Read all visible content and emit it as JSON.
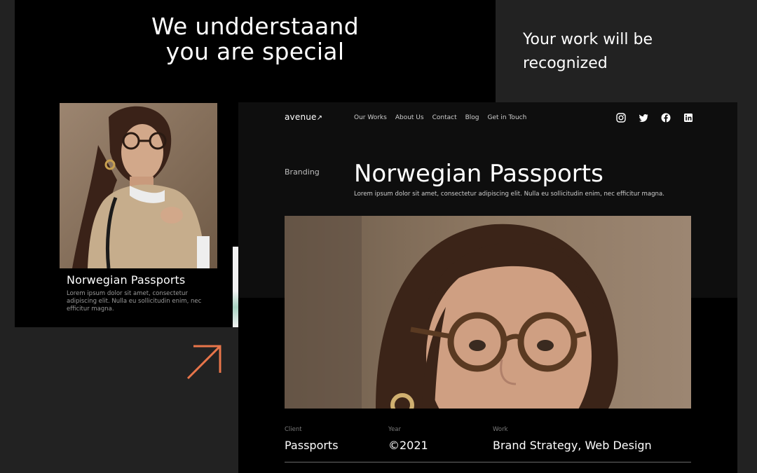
{
  "left_panel": {
    "heading_line1": "We undderstaand",
    "heading_line2": "you are special",
    "card": {
      "title": "Norwegian Passports",
      "description": "Lorem ipsum dolor sit amet, consectetur adipiscing elit. Nulla eu sollicitudin enim, nec efficitur magna."
    }
  },
  "tagline": "Your work will be recognized",
  "decor": {
    "arrow_icon": "arrow-up-right-icon",
    "arrow_color": "#e8754a"
  },
  "site": {
    "logo": "avenue",
    "logo_icon": "arrow-up-right-icon",
    "nav": [
      "Our Works",
      "About Us",
      "Contact",
      "Blog",
      "Get in Touch"
    ],
    "social_icons": [
      "instagram-icon",
      "twitter-icon",
      "facebook-icon",
      "linkedin-icon"
    ],
    "category": "Branding",
    "project_title": "Norwegian Passports",
    "project_lead": "Lorem ipsum dolor sit amet, consectetur adipiscing elit. Nulla eu sollicitudin enim, nec efficitur magna.",
    "meta": [
      {
        "label": "Client",
        "value": "Passports"
      },
      {
        "label": "Year",
        "value": "©2021"
      },
      {
        "label": "Work",
        "value": "Brand Strategy, Web Design"
      }
    ]
  }
}
